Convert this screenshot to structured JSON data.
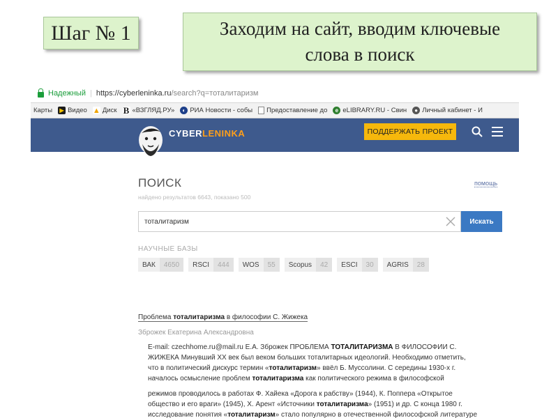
{
  "slide": {
    "step_label": "Шаг № 1",
    "headline_line1": "Заходим на сайт, вводим ключевые",
    "headline_line2": "слова в поиск"
  },
  "browser": {
    "secure_label": "Надежный",
    "url_host": "https://cyberleninka.ru",
    "url_rest": "/search?q=тоталитаризм",
    "bookmarks": [
      "Карты",
      "Видео",
      "Диск",
      "«ВЗГЛЯД.РУ»",
      "РИА Новости - собы",
      "Предоставление до",
      "eLIBRARY.RU - Свин",
      "Личный кабинет - И"
    ]
  },
  "site": {
    "logo_part1": "CYBER",
    "logo_part2": "LENINKA",
    "support_button": "ПОДДЕРЖАТЬ ПРОЕКТ",
    "page_title": "ПОИСК",
    "help_link": "помощь",
    "results_count": "найдено результатов 6643, показано 500",
    "search_value": "тоталитаризм",
    "search_button": "Искать",
    "databases_label": "НАУЧНЫЕ БАЗЫ",
    "databases": [
      {
        "name": "ВАК",
        "count": "4650"
      },
      {
        "name": "RSCI",
        "count": "444"
      },
      {
        "name": "WOS",
        "count": "55"
      },
      {
        "name": "Scopus",
        "count": "42"
      },
      {
        "name": "ESCI",
        "count": "30"
      },
      {
        "name": "AGRIS",
        "count": "28"
      }
    ]
  },
  "result": {
    "title_pre": "Проблема ",
    "title_bold": "тоталитаризма",
    "title_post": " в философии С. Жижека",
    "author": "Зброжек Екатерина Александровна",
    "p1": [
      [
        "E-mail: czechhome.ru@mail.ru Е.А. Зброжек ПРОБЛЕМА ",
        "ТОТАЛИТАРИЗМА",
        " В ФИЛОСОФИИ С."
      ],
      [
        "ЖИЖЕКА Минувший XX век был веком больших тоталитарных идеологий. Необходимо отметить,",
        "",
        ""
      ],
      [
        "что в политический дискурс термин «",
        "тоталитаризм",
        "» ввёл Б. Муссолини. С середины 1930-х г."
      ],
      [
        "началось осмысление проблем ",
        "тоталитаризма",
        " как политического режима в философской"
      ]
    ],
    "p2": [
      [
        "режимов проводилось в работах Ф. Хайека «Дорога к рабству» (1944), К. Поппера «Открытое",
        "",
        ""
      ],
      [
        "общество и его враги» (1945), Х. Арент «Источники ",
        "тоталитаризма",
        "» (1951) и др. С конца 1980 г."
      ],
      [
        "исследование понятия «",
        "тоталитаризм",
        "» стало популярно в отечественной философской литературе"
      ]
    ]
  }
}
